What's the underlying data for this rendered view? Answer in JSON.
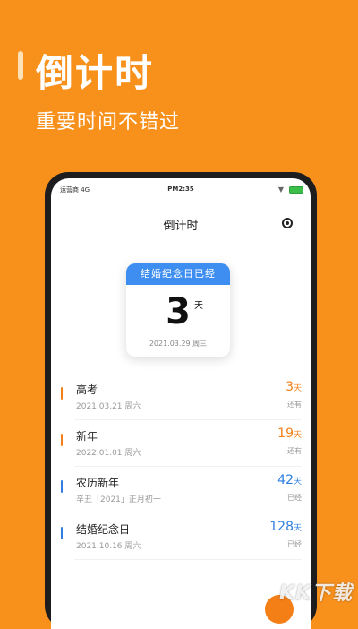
{
  "promo": {
    "title": "倒计时",
    "subtitle": "重要时间不错过"
  },
  "status_bar": {
    "carrier": "运营商 4G",
    "time": "PM2:35"
  },
  "app": {
    "title": "倒计时"
  },
  "featured": {
    "header": "结婚纪念日已经",
    "number": "3",
    "unit": "天",
    "date": "2021.03.29  周三"
  },
  "events": [
    {
      "name": "高考",
      "date": "2021.03.21 周六",
      "days": "3",
      "unit": "天",
      "status": "还有",
      "color": "#F57F17"
    },
    {
      "name": "新年",
      "date": "2022.01.01 周六",
      "days": "19",
      "unit": "天",
      "status": "还有",
      "color": "#F57F17"
    },
    {
      "name": "农历新年",
      "date": "辛丑「2021」正月初一",
      "days": "42",
      "unit": "天",
      "status": "已经",
      "color": "#2F7FE3"
    },
    {
      "name": "结婚纪念日",
      "date": "2021.10.16 周六",
      "days": "128",
      "unit": "天",
      "status": "已经",
      "color": "#2F7FE3"
    }
  ],
  "watermark": "KK下载",
  "colors": {
    "background": "#F8901C",
    "accent_blue": "#3D8EF0",
    "accent_orange": "#F57F17"
  }
}
